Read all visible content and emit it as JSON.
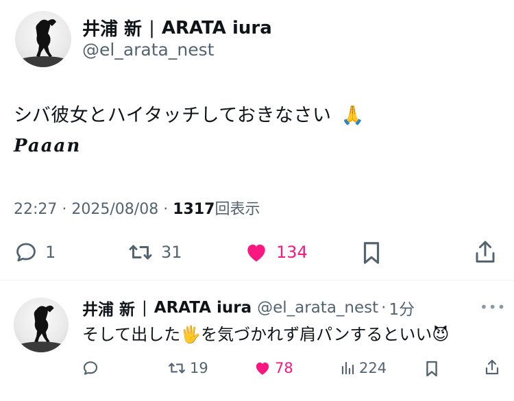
{
  "tweet": {
    "display_name": "井浦 新",
    "name_separator": "|",
    "display_name_en": "ARATA iura",
    "handle": "@el_arata_nest",
    "text": "シバ彼女とハイタッチしておきなさい",
    "text_emoji": "🙏",
    "sub_text": "Paaan",
    "time": "22:27",
    "date": "2025/08/08",
    "views_count": "1317",
    "views_label": "回表示",
    "meta_dot": "·",
    "replies": "1",
    "retweets": "31",
    "likes": "134"
  },
  "reply": {
    "display_name": "井浦 新",
    "name_separator": "|",
    "display_name_en": "ARATA iura",
    "handle": "@el_arata_nest",
    "time_dot": "·",
    "time": "1分",
    "more": "•••",
    "text_before": "そして出した",
    "emoji_hand": "🖐",
    "text_after": "を気づかれず肩パンするといい",
    "emoji_devil": "😈",
    "replies": "",
    "retweets": "19",
    "likes": "78",
    "views": "224"
  },
  "colors": {
    "like": "#f91880",
    "secondary_text": "#536471",
    "primary_text": "#0f1419",
    "divider": "#eff3f4"
  },
  "icons": {
    "reply": "speech-bubble-icon",
    "retweet": "retweet-arrows-icon",
    "like": "heart-filled-icon",
    "bookmark": "bookmark-icon",
    "share": "share-upload-icon",
    "views": "bar-chart-icon",
    "more": "ellipsis-icon"
  }
}
